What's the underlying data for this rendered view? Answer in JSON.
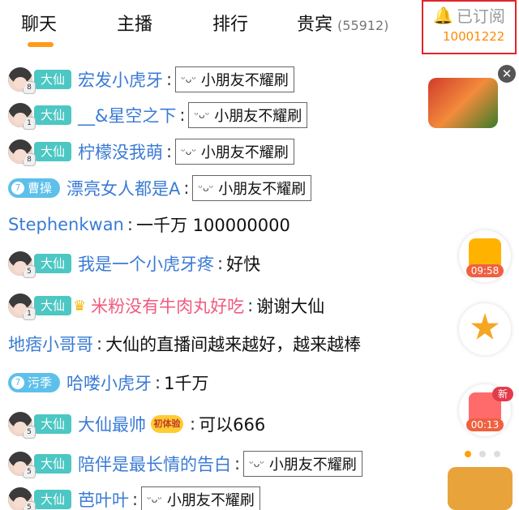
{
  "tabs": [
    {
      "label": "聊天"
    },
    {
      "label": "主播"
    },
    {
      "label": "排行"
    },
    {
      "label": "贵宾",
      "count": "(55912)"
    }
  ],
  "subscribe": {
    "label": "已订阅",
    "count": "10001222"
  },
  "chat": [
    {
      "name": "宏发小虎牙",
      "level": "8",
      "badge": "大仙",
      "sticker": "小朋友不耀刷"
    },
    {
      "name": "__&星空之下",
      "level": "1",
      "badge": "大仙",
      "sticker": "小朋友不耀刷"
    },
    {
      "name": "柠檬没我萌",
      "level": "8",
      "badge": "大仙",
      "sticker": "小朋友不耀刷"
    },
    {
      "name": "漂亮女人都是A",
      "badge_num": "7",
      "badge": "曹操",
      "sticker": "小朋友不耀刷"
    },
    {
      "name": "Stephenkwan",
      "message": "一千万 100000000"
    },
    {
      "name": "我是一个小虎牙疼",
      "level": "5",
      "badge": "大仙",
      "message": "好快"
    },
    {
      "name": "米粉没有牛肉丸好吃",
      "level": "1",
      "badge": "大仙",
      "message": "谢谢大仙"
    },
    {
      "name": "地痞小哥哥",
      "message": "大仙的直播间越来越好，越来越棒"
    },
    {
      "name": "哈喽小虎牙",
      "badge_num": "7",
      "badge": "污季",
      "message": "1千万"
    },
    {
      "name": "大仙最帅",
      "level": "5",
      "badge": "大仙",
      "medal": "初体验",
      "message": "可以666"
    },
    {
      "name": "陪伴是最长情的告白",
      "level": "5",
      "badge": "大仙",
      "sticker": "小朋友不耀刷"
    },
    {
      "name": "芭叶叶",
      "level": "5",
      "badge": "大仙",
      "sticker": "小朋友不耀刷"
    }
  ],
  "side": {
    "timer1": "09:58",
    "timer2": "00:13",
    "new_label": "新"
  },
  "icons": {
    "close": "close-icon",
    "bell": "bell-icon"
  },
  "colors": {
    "accent": "#ff9a1a",
    "name_blue": "#3a7bd5",
    "name_pink": "#f05a7e",
    "badge_teal": "#4cc7c3",
    "highlight_red": "#e0252b"
  }
}
